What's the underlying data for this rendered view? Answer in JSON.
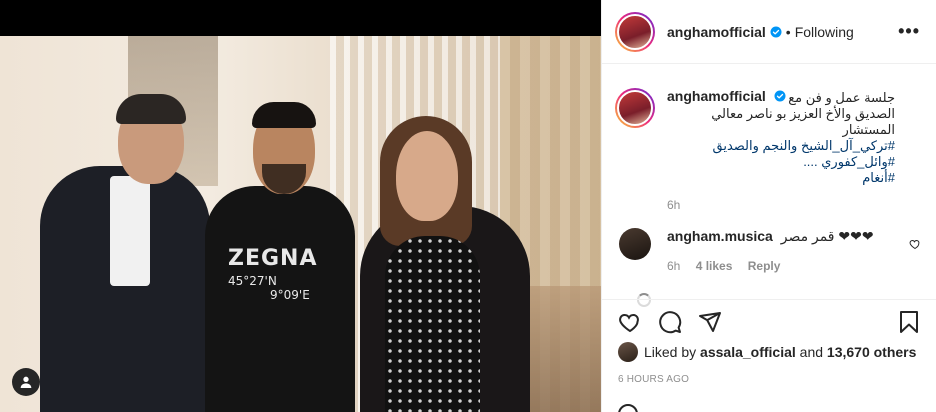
{
  "post": {
    "username": "anghamofficial",
    "follow_status": "Following",
    "more_label": "•••",
    "separator": "•"
  },
  "caption": {
    "username": "anghamofficial",
    "line1": "جلسة عمل و فن مع",
    "line2": "الصديق والأخ العزيز بو ناصر معالي المستشار",
    "line3": "#تركي_آل_الشيخ والنجم والصديق #وائل_كفوري ....",
    "line4": "#أنغام",
    "time": "6h"
  },
  "comments": [
    {
      "username": "angham.musica",
      "text": "قمر مصر ❤❤❤",
      "time": "6h",
      "likes": "4 likes",
      "reply": "Reply"
    }
  ],
  "likes": {
    "prefix": "Liked by",
    "user": "assala_official",
    "middle": "and",
    "count": "13,670 others"
  },
  "posted_ago": "6 HOURS AGO",
  "photo_text": {
    "brand": "ZEGNA",
    "coord1": "45°27'N",
    "coord2": "9°09'E"
  },
  "colors": {
    "verified": "#0095f6",
    "link": "#00376b",
    "muted": "#8e8e8e",
    "text": "#262626"
  },
  "icons": [
    "user-tag-icon",
    "verified-icon",
    "more-icon",
    "heart-icon",
    "comment-icon",
    "share-icon",
    "bookmark-icon"
  ]
}
